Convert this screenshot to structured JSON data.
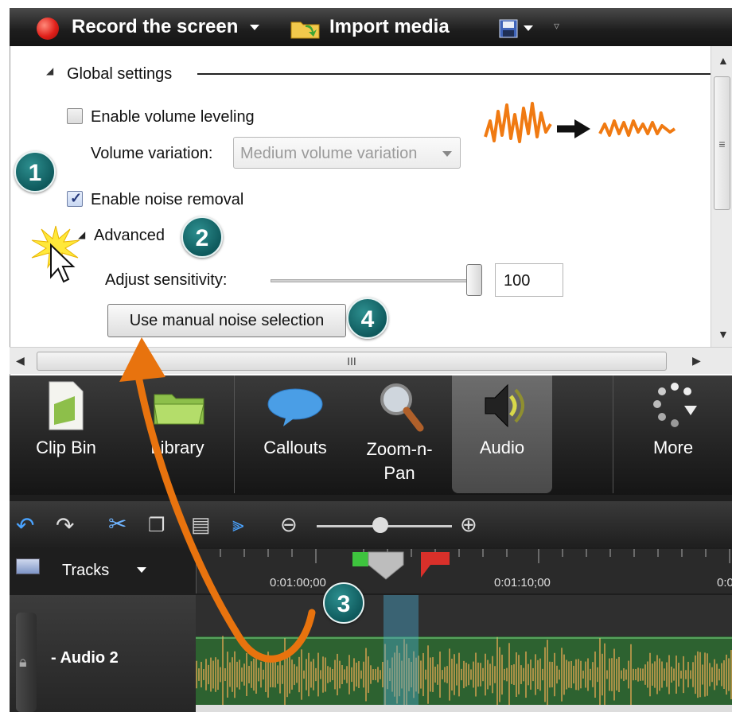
{
  "toolbar": {
    "record_label": "Record the screen",
    "import_label": "Import media"
  },
  "panel": {
    "section_title": "Global settings",
    "volume_leveling_label": "Enable volume leveling",
    "volume_leveling_checked": false,
    "volume_variation_label": "Volume variation:",
    "volume_variation_value": "Medium volume variation",
    "noise_removal_label": "Enable noise removal",
    "noise_removal_checked": true,
    "advanced_label": "Advanced",
    "sensitivity_label": "Adjust sensitivity:",
    "sensitivity_value": "100",
    "sensitivity_fraction": 1.0,
    "manual_noise_button": "Use manual noise selection"
  },
  "callouts": {
    "one": "1",
    "two": "2",
    "three": "3",
    "four": "4",
    "color": "#0f5a5d",
    "arrow_color": "#e8730e"
  },
  "tabs": [
    {
      "label": "Clip Bin",
      "icon": "clip-bin-icon"
    },
    {
      "label": "Library",
      "icon": "library-folder-icon"
    },
    {
      "label": "Callouts",
      "icon": "speech-bubble-icon"
    },
    {
      "label": "Zoom-n-Pan",
      "icon": "magnifier-icon"
    },
    {
      "label": "Audio",
      "icon": "speaker-icon"
    },
    {
      "label": "More",
      "icon": "more-dots-icon"
    }
  ],
  "timeline": {
    "tracks_label": "Tracks",
    "time_1": "0:01:00;00",
    "time_2": "0:01:10;00",
    "time_3": "0:0",
    "track_name": "- Audio 2"
  },
  "scrollbar_glyph": "III"
}
